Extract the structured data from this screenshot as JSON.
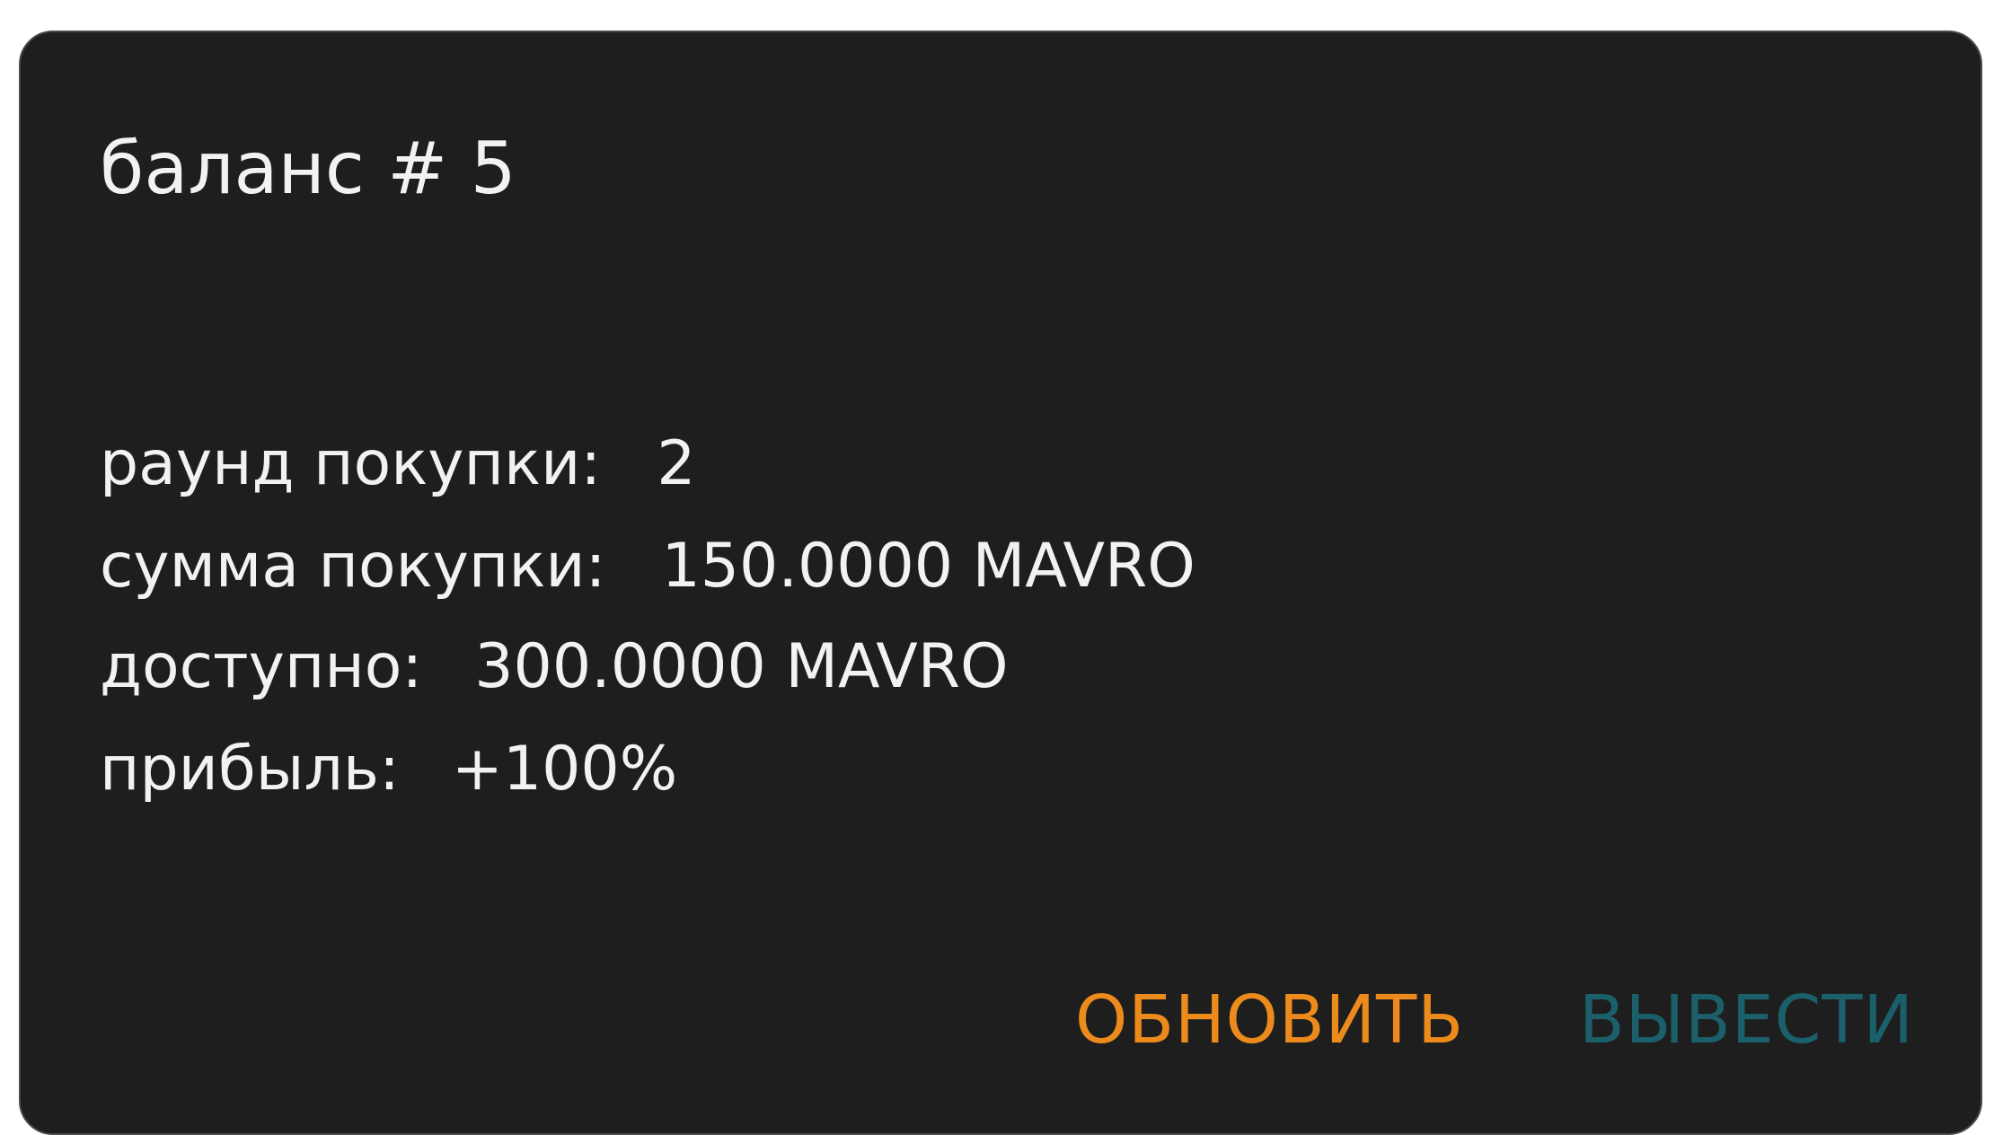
{
  "card": {
    "title": "баланс # 5",
    "rows": [
      {
        "label": "раунд покупки:",
        "value": "2"
      },
      {
        "label": "сумма покупки:",
        "value": "150.0000 MAVRO"
      },
      {
        "label": "доступно:",
        "value": "300.0000 MAVRO"
      },
      {
        "label": "прибыль:",
        "value": "+100%"
      }
    ],
    "actions": {
      "refresh_label": "ОБНОВИТЬ",
      "withdraw_label": "ВЫВЕСТИ"
    }
  },
  "colors": {
    "card_background": "#1e1e1e",
    "text": "#f2f2f2",
    "refresh_accent": "#ec8b1c",
    "withdraw_accent": "#1b5f6b"
  }
}
